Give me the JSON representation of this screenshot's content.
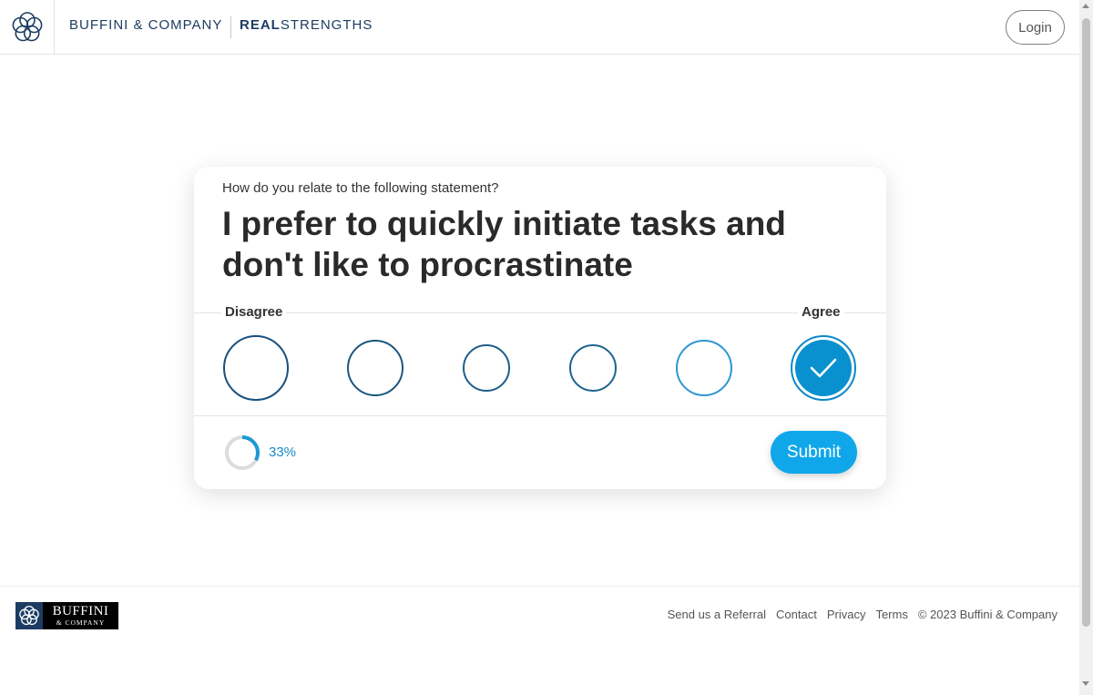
{
  "header": {
    "brand": "BUFFINI & COMPANY",
    "product_bold": "REAL",
    "product_rest": "STRENGTHS",
    "login_label": "Login"
  },
  "question": {
    "prompt": "How do you relate to the following statement?",
    "statement": "I prefer to quickly initiate tasks and don't like to procrastinate",
    "scale_left": "Disagree",
    "scale_right": "Agree",
    "options_count": 6,
    "selected_option": 6
  },
  "progress": {
    "value": 0.33,
    "label": "33%"
  },
  "submit_label": "Submit",
  "footer": {
    "logo_word": "BUFFINI",
    "logo_sub": "& COMPANY",
    "links": [
      "Send us a Referral",
      "Contact",
      "Privacy",
      "Terms"
    ],
    "copyright": "© 2023 Buffini & Company"
  },
  "colors": {
    "navy": "#1d3c62",
    "accent": "#0fa7ea",
    "selected": "#0990cf"
  }
}
